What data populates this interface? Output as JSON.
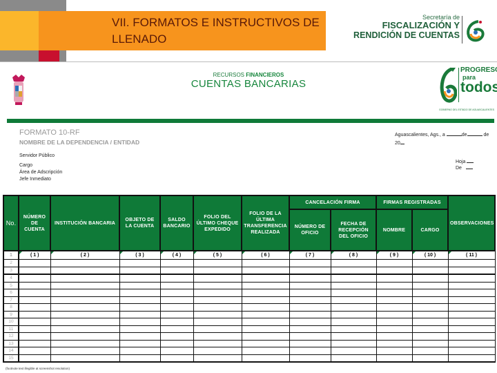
{
  "slide": {
    "title": "VII. FORMATOS E INSTRUCTIVOS DE LLENADO",
    "org_logo": {
      "line1": "Secretaría de",
      "line2": "FISCALIZACIÓN Y",
      "line3": "RENDICIÓN DE CUENTAS"
    }
  },
  "sheet": {
    "subtitle_prefix": "RECURSOS ",
    "subtitle_bold": "FINANCIEROS",
    "title": "CUENTAS BANCARIAS",
    "right_logo": {
      "line1": "PROGRESO",
      "line2": "para",
      "line3": "todos",
      "caption": "GOBIERNO DEL ESTADO DE AGUASCALIENTES"
    },
    "format_code": "FORMATO 10-RF",
    "dependency_label": "NOMBRE DE LA DEPENDENCIA / ENTIDAD",
    "fields": [
      "Servidor Público",
      "Cargo",
      "Área de Adscripción",
      "Jefe Inmediato"
    ],
    "date_line": {
      "prefix": "Aguascalientes, Ags., a",
      "de1": "de",
      "de2": "de",
      "year_prefix": "20"
    },
    "hoja_label": "Hoja",
    "de_label": "De",
    "table": {
      "group_headers": {
        "cancelacion": "CANCELACIÓN FIRMA",
        "firmas": "FIRMAS REGISTRADAS"
      },
      "columns": [
        {
          "key": "no",
          "label": "No."
        },
        {
          "key": "numero_cuenta",
          "label": "NÚMERO DE CUENTA",
          "index": "( 1 )"
        },
        {
          "key": "institucion",
          "label": "INSTITUCIÓN BANCARIA",
          "index": "( 2 )"
        },
        {
          "key": "objeto",
          "label": "OBJETO DE LA CUENTA",
          "index": "( 3 )"
        },
        {
          "key": "saldo",
          "label": "SALDO BANCARIO",
          "index": "( 4 )"
        },
        {
          "key": "folio_cheque",
          "label": "FOLIO DEL ÚLTIMO CHEQUE EXPEDIDO",
          "index": "( 5 )"
        },
        {
          "key": "folio_transferencia",
          "label": "FOLIO DE LA ÚLTIMA TRANSFERENCIA REALIZADA",
          "index": "( 6 )"
        },
        {
          "key": "numero_oficio",
          "label": "NÚMERO DE OFICIO",
          "index": "( 7 )"
        },
        {
          "key": "fecha_recepcion",
          "label": "FECHA DE RECEPCIÓN DEL OFICIO",
          "index": "( 8 )"
        },
        {
          "key": "nombre",
          "label": "NOMBRE",
          "index": "( 9 )"
        },
        {
          "key": "cargo",
          "label": "CARGO",
          "index": "( 10 )"
        },
        {
          "key": "observaciones",
          "label": "OBSERVACIONES",
          "index": "( 11 )"
        }
      ],
      "row_numbers": [
        "1",
        "2",
        "3",
        "4",
        "5",
        "6",
        "7",
        "8",
        "9",
        "10",
        "11",
        "12",
        "13",
        "14",
        "15"
      ]
    },
    "footnote": "(footnote text illegible at screenshot resolution)"
  }
}
